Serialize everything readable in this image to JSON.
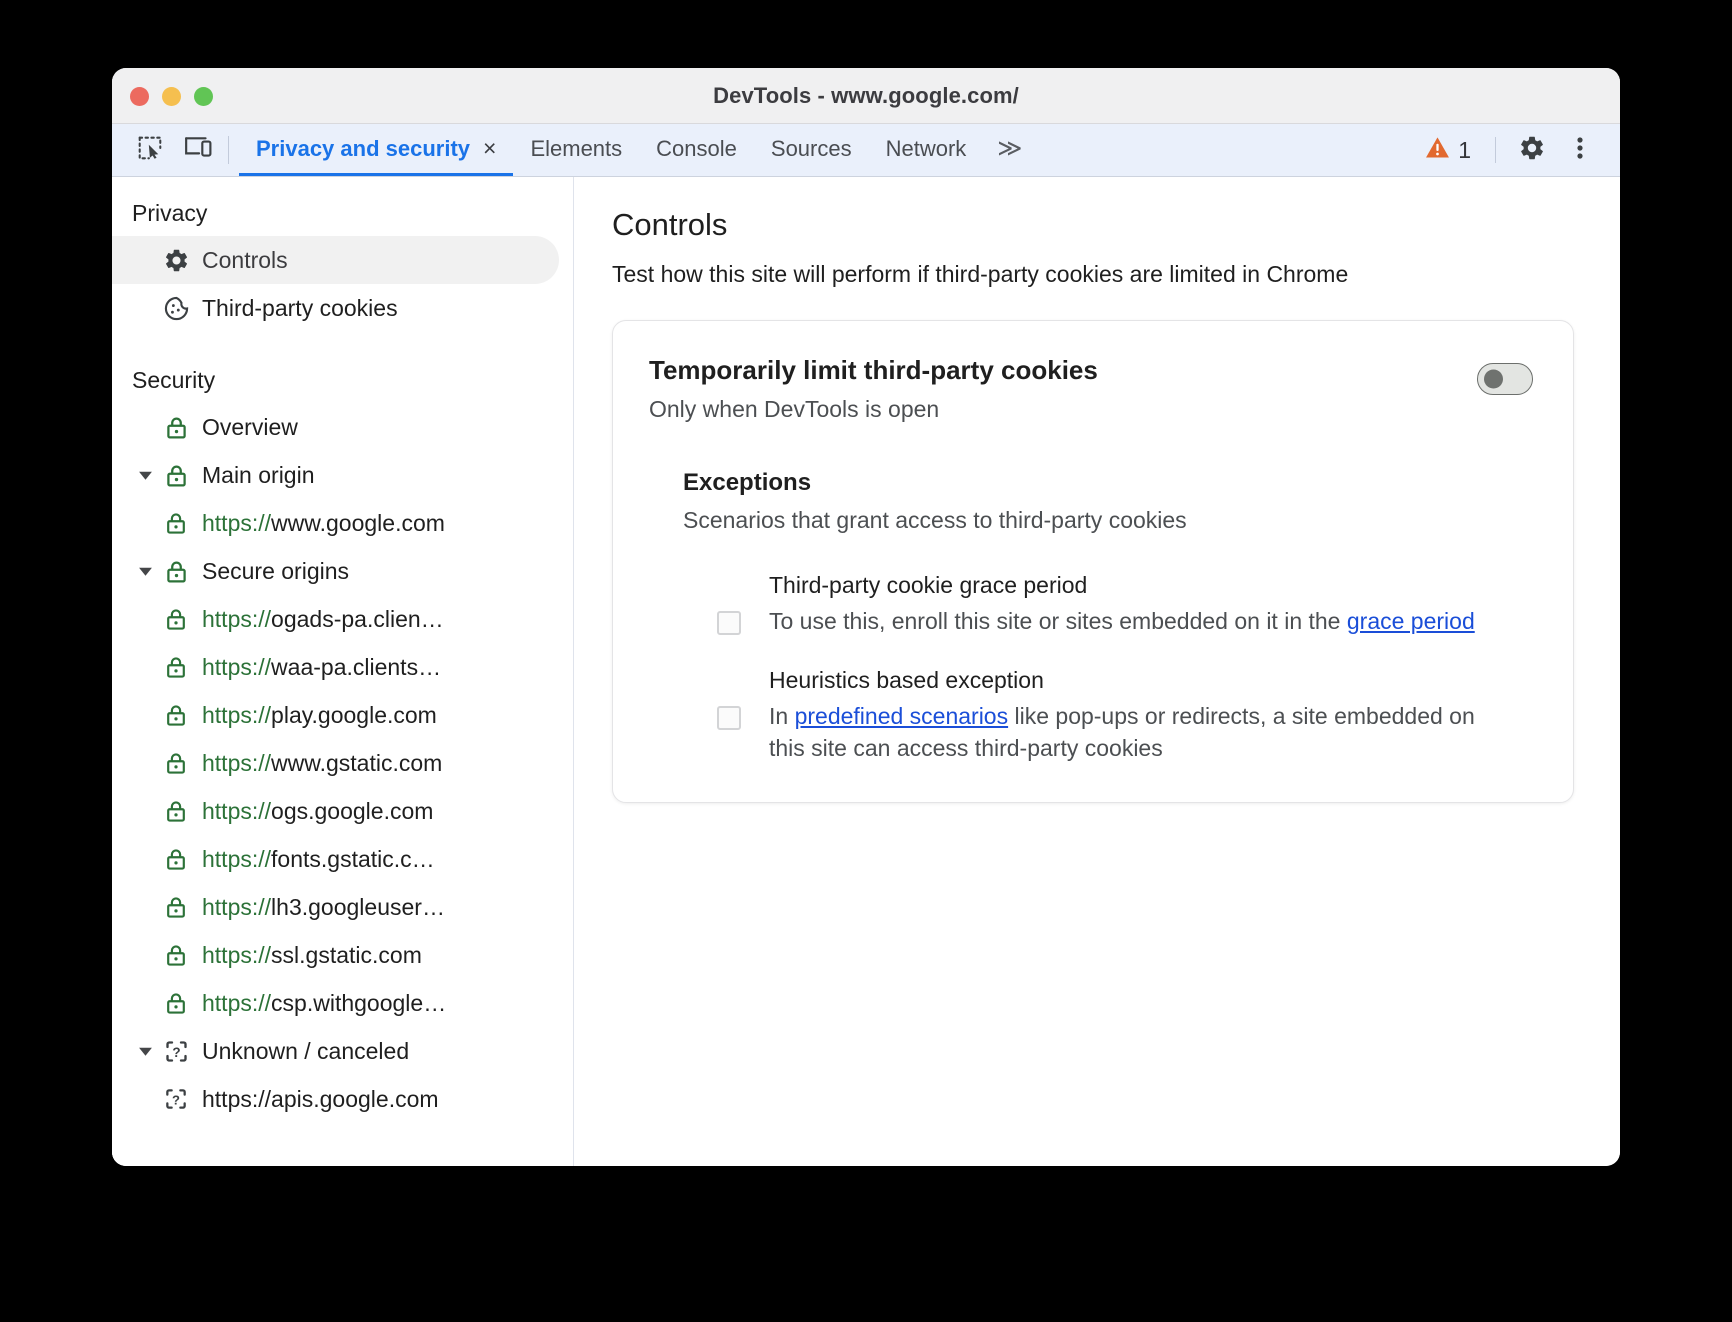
{
  "window": {
    "title": "DevTools - www.google.com/",
    "traffic_lights": [
      "close",
      "minimize",
      "maximize"
    ]
  },
  "tabbar": {
    "inspect_icon": "inspect-element-icon",
    "device_icon": "device-toolbar-icon",
    "tabs": [
      {
        "label": "Privacy and security",
        "active": true,
        "closable": true,
        "close_glyph": "×"
      },
      {
        "label": "Elements",
        "active": false
      },
      {
        "label": "Console",
        "active": false
      },
      {
        "label": "Sources",
        "active": false
      },
      {
        "label": "Network",
        "active": false
      }
    ],
    "more_tabs_glyph": "≫",
    "warning_count": "1",
    "warning_color": "#e2692f",
    "settings_icon": "gear-icon",
    "more_options_icon": "kebab-menu-icon"
  },
  "sidebar": {
    "privacy": {
      "title": "Privacy",
      "items": [
        {
          "label": "Controls",
          "icon": "gear-icon",
          "selected": true
        },
        {
          "label": "Third-party cookies",
          "icon": "cookie-icon",
          "selected": false
        }
      ]
    },
    "security": {
      "title": "Security",
      "overview": {
        "label": "Overview",
        "icon": "lock-icon"
      },
      "groups": [
        {
          "label": "Main origin",
          "icon": "lock-icon",
          "expanded": true,
          "origins": [
            {
              "scheme": "https://",
              "host": "www.google.com",
              "icon": "lock-icon",
              "secure": true
            }
          ]
        },
        {
          "label": "Secure origins",
          "icon": "lock-icon",
          "expanded": true,
          "origins": [
            {
              "scheme": "https://",
              "host": "ogads-pa.clien…",
              "icon": "lock-icon",
              "secure": true
            },
            {
              "scheme": "https://",
              "host": "waa-pa.clients…",
              "icon": "lock-icon",
              "secure": true
            },
            {
              "scheme": "https://",
              "host": "play.google.com",
              "icon": "lock-icon",
              "secure": true
            },
            {
              "scheme": "https://",
              "host": "www.gstatic.com",
              "icon": "lock-icon",
              "secure": true
            },
            {
              "scheme": "https://",
              "host": "ogs.google.com",
              "icon": "lock-icon",
              "secure": true
            },
            {
              "scheme": "https://",
              "host": "fonts.gstatic.c…",
              "icon": "lock-icon",
              "secure": true
            },
            {
              "scheme": "https://",
              "host": "lh3.googleuser…",
              "icon": "lock-icon",
              "secure": true
            },
            {
              "scheme": "https://",
              "host": "ssl.gstatic.com",
              "icon": "lock-icon",
              "secure": true
            },
            {
              "scheme": "https://",
              "host": "csp.withgoogle…",
              "icon": "lock-icon",
              "secure": true
            }
          ]
        },
        {
          "label": "Unknown / canceled",
          "icon": "unknown-icon",
          "expanded": true,
          "origins": [
            {
              "scheme": "https://",
              "host": "apis.google.com",
              "icon": "unknown-icon",
              "secure": false
            }
          ]
        }
      ]
    }
  },
  "main": {
    "heading": "Controls",
    "subtitle": "Test how this site will perform if third-party cookies are limited in Chrome",
    "card": {
      "title": "Temporarily limit third-party cookies",
      "subtitle": "Only when DevTools is open",
      "toggle": {
        "name": "limit-third-party-cookies-toggle",
        "checked": false
      },
      "exceptions": {
        "title": "Exceptions",
        "subtitle": "Scenarios that grant access to third-party cookies",
        "items": [
          {
            "name": "Third-party cookie grace period",
            "checked": false,
            "desc_before": "To use this, enroll this site or sites embedded on it in the ",
            "link_text": "grace period",
            "desc_after": ""
          },
          {
            "name": "Heuristics based exception",
            "checked": false,
            "desc_before": "In ",
            "link_text": "predefined scenarios",
            "desc_after": " like pop-ups or redirects, a site embedded on this site can access third-party cookies"
          }
        ]
      }
    }
  },
  "colors": {
    "accent": "#1a73e8",
    "secure_green": "#2c7238",
    "warning_orange": "#e2692f",
    "link_blue": "#1a4ed8"
  }
}
